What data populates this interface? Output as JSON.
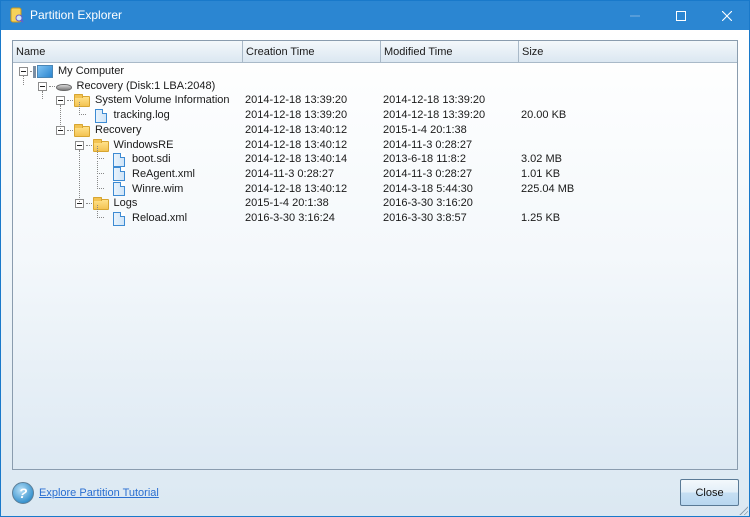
{
  "window": {
    "title": "Partition Explorer",
    "icon": "partition-explorer-app-icon",
    "controls": {
      "minimize": "minimize-icon",
      "maximize": "maximize-icon",
      "close": "close-icon"
    }
  },
  "table": {
    "columns": [
      "Name",
      "Creation Time",
      "Modified Time",
      "Size"
    ],
    "rows": [
      {
        "name": "My Computer",
        "level": 0,
        "icon": "computer-icon",
        "expanded": true,
        "ctime": "",
        "mtime": "",
        "size": ""
      },
      {
        "name": "Recovery (Disk:1 LBA:2048)",
        "level": 1,
        "icon": "disk-icon",
        "expanded": true,
        "ctime": "",
        "mtime": "",
        "size": ""
      },
      {
        "name": "System Volume Information",
        "level": 2,
        "icon": "folder-icon",
        "expanded": true,
        "ctime": "2014-12-18 13:39:20",
        "mtime": "2014-12-18 13:39:20",
        "size": ""
      },
      {
        "name": "tracking.log",
        "level": 3,
        "icon": "file-icon",
        "ctime": "2014-12-18 13:39:20",
        "mtime": "2014-12-18 13:39:20",
        "size": "20.00 KB"
      },
      {
        "name": "Recovery",
        "level": 2,
        "icon": "folder-icon",
        "expanded": true,
        "ctime": "2014-12-18 13:40:12",
        "mtime": "2015-1-4 20:1:38",
        "size": ""
      },
      {
        "name": "WindowsRE",
        "level": 3,
        "icon": "folder-icon",
        "expanded": true,
        "ctime": "2014-12-18 13:40:12",
        "mtime": "2014-11-3 0:28:27",
        "size": ""
      },
      {
        "name": "boot.sdi",
        "level": 4,
        "icon": "file-icon",
        "ctime": "2014-12-18 13:40:14",
        "mtime": "2013-6-18 11:8:2",
        "size": "3.02 MB"
      },
      {
        "name": "ReAgent.xml",
        "level": 4,
        "icon": "file-icon",
        "ctime": "2014-11-3 0:28:27",
        "mtime": "2014-11-3 0:28:27",
        "size": "1.01 KB"
      },
      {
        "name": "Winre.wim",
        "level": 4,
        "icon": "file-icon",
        "ctime": "2014-12-18 13:40:12",
        "mtime": "2014-3-18 5:44:30",
        "size": "225.04 MB"
      },
      {
        "name": "Logs",
        "level": 3,
        "icon": "folder-icon",
        "expanded": true,
        "ctime": "2015-1-4 20:1:38",
        "mtime": "2016-3-30 3:16:20",
        "size": ""
      },
      {
        "name": "Reload.xml",
        "level": 4,
        "icon": "file-icon",
        "ctime": "2016-3-30 3:16:24",
        "mtime": "2016-3-30 3:8:57",
        "size": "1.25 KB"
      }
    ]
  },
  "footer": {
    "help_icon": "help-icon",
    "tutorial_link": "Explore Partition Tutorial",
    "close_label": "Close"
  },
  "colors": {
    "titlebar": "#2b86d2",
    "link": "#2a6fd1"
  }
}
